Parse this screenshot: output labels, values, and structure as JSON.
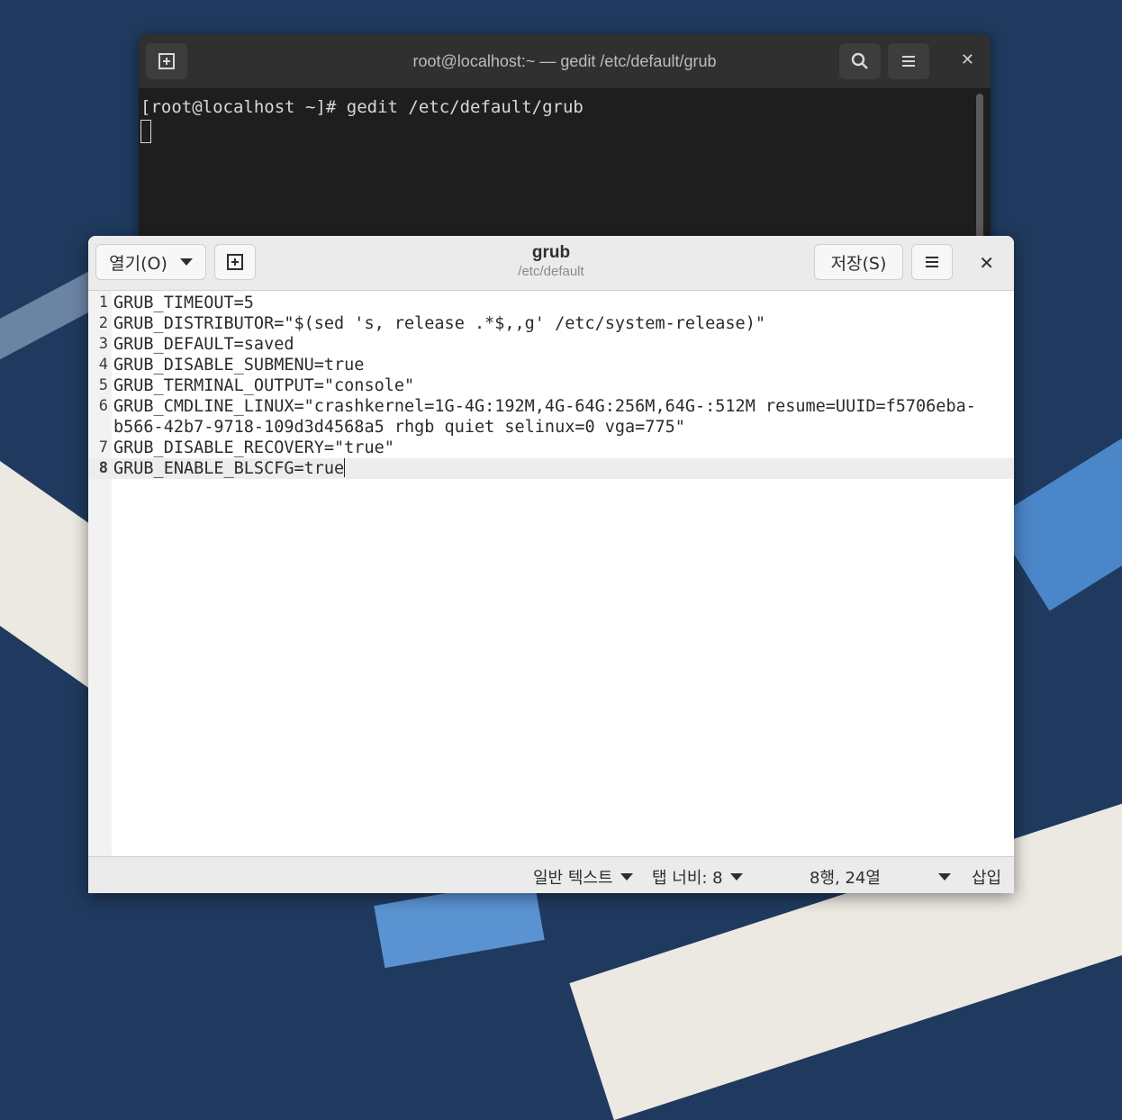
{
  "terminal": {
    "title": "root@localhost:~ — gedit /etc/default/grub",
    "command_line": "[root@localhost ~]# gedit /etc/default/grub",
    "new_tab_icon": "new-tab-icon",
    "search_icon": "search-icon",
    "menu_icon": "hamburger-menu-icon",
    "close_icon": "close-icon"
  },
  "gedit": {
    "open_label": "열기(O)",
    "title": "grub",
    "subtitle": "/etc/default",
    "save_label": "저장(S)",
    "lines": [
      {
        "num": "1",
        "text": "GRUB_TIMEOUT=5"
      },
      {
        "num": "2",
        "text": "GRUB_DISTRIBUTOR=\"$(sed 's, release .*$,,g' /etc/system-release)\""
      },
      {
        "num": "3",
        "text": "GRUB_DEFAULT=saved"
      },
      {
        "num": "4",
        "text": "GRUB_DISABLE_SUBMENU=true"
      },
      {
        "num": "5",
        "text": "GRUB_TERMINAL_OUTPUT=\"console\""
      },
      {
        "num": "6",
        "text": "GRUB_CMDLINE_LINUX=\"crashkernel=1G-4G:192M,4G-64G:256M,64G-:512M resume=UUID=f5706eba-"
      },
      {
        "num": "",
        "text": "b566-42b7-9718-109d3d4568a5 rhgb quiet selinux=0 vga=775\""
      },
      {
        "num": "7",
        "text": "GRUB_DISABLE_RECOVERY=\"true\""
      },
      {
        "num": "8",
        "text": "GRUB_ENABLE_BLSCFG=true"
      }
    ],
    "status": {
      "language": "일반 텍스트",
      "tab_width": "탭 너비: 8",
      "position": "8행, 24열",
      "mode": "삽입"
    }
  }
}
